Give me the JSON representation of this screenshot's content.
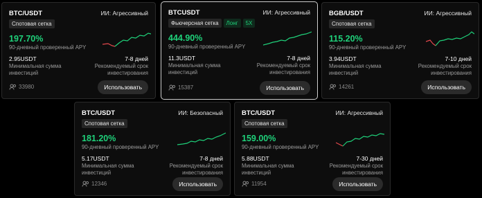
{
  "labels": {
    "apy": "90-дневный проверенный APY",
    "min": "Минимальная сумма инвестиций",
    "period": "Рекомендуемый срок инвестирования",
    "button": "Использовать"
  },
  "cards": [
    {
      "pair": "BTC/USDT",
      "ai": "ИИ: Агрессивный",
      "tags": [
        "Спотовая сетка"
      ],
      "apy": "197.70%",
      "min": "2.95USDT",
      "period": "7-8 дней",
      "users": "33980"
    },
    {
      "pair": "BTCUSDT",
      "ai": "ИИ: Агрессивный",
      "tags": [
        "Фьючерсная сетка",
        "Лонг",
        "5X"
      ],
      "apy": "444.90%",
      "min": "11.3USDT",
      "period": "7-8 дней",
      "users": "15387"
    },
    {
      "pair": "BGB/USDT",
      "ai": "ИИ: Агрессивный",
      "tags": [
        "Спотовая сетка"
      ],
      "apy": "115.20%",
      "min": "3.94USDT",
      "period": "7-10 дней",
      "users": "14261"
    },
    {
      "pair": "BTC/USDT",
      "ai": "ИИ: Безопасный",
      "tags": [
        "Спотовая сетка"
      ],
      "apy": "181.20%",
      "min": "5.17USDT",
      "period": "7-8 дней",
      "users": "12346"
    },
    {
      "pair": "BTC/USDT",
      "ai": "ИИ: Агрессивный",
      "tags": [
        "Спотовая сетка"
      ],
      "apy": "159.00%",
      "min": "5.88USDT",
      "period": "7-30 дней",
      "users": "11954"
    }
  ],
  "colors": {
    "up": "#1fd17a",
    "down": "#e5484d"
  }
}
